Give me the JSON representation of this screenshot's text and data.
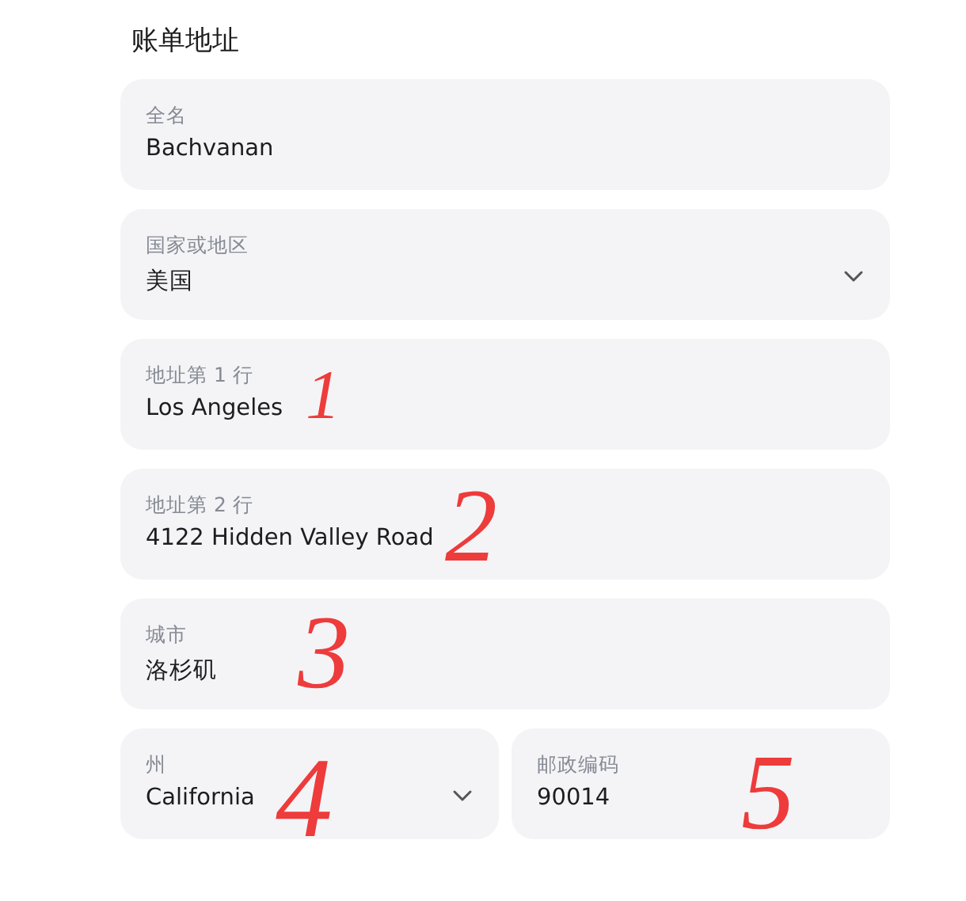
{
  "heading": "账单地址",
  "rows": [
    [
      {
        "kind": "text",
        "label": "全名",
        "value": "Bachvanan"
      }
    ],
    [
      {
        "kind": "select",
        "label": "国家或地区",
        "value": "美国"
      }
    ],
    [
      {
        "kind": "text",
        "label": "地址第 1 行",
        "value": "Los Angeles",
        "annotation": "1"
      }
    ],
    [
      {
        "kind": "text",
        "label": "地址第 2 行",
        "value": "4122 Hidden Valley Road",
        "annotation": "2"
      }
    ],
    [
      {
        "kind": "text",
        "label": "城市",
        "value": "洛杉矶",
        "annotation": "3"
      }
    ],
    [
      {
        "kind": "select",
        "label": "州",
        "value": "California",
        "annotation": "4"
      },
      {
        "kind": "text",
        "label": "邮政编码",
        "value": "90014",
        "annotation": "5"
      }
    ]
  ]
}
